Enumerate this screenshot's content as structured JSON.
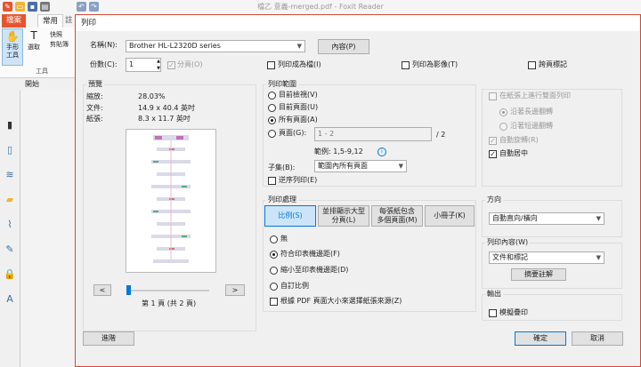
{
  "app": {
    "title": "檔乙 意義-merged.pdf - Foxit Reader",
    "tabs": [
      "檔案",
      "常用",
      "註"
    ],
    "tools": {
      "hand_label": "手形\n工具",
      "select_label": "選取",
      "snapshot_label": "快照",
      "clipboard_label": "剪貼簿",
      "group_label": "工具"
    },
    "doc_tab": "開始"
  },
  "dialog": {
    "title": "列印",
    "printer": {
      "name_label": "名稱(N):",
      "name_value": "Brother HL-L2320D series",
      "properties_button": "內容(P)"
    },
    "copies": {
      "label": "份數(C):",
      "value": "1",
      "collate_label": "分頁(O)"
    },
    "print_to_file_label": "列印成為檔(I)",
    "print_as_image_label": "列印為影像(T)",
    "cross_page_label": "跨頁標記",
    "preview": {
      "title": "預覽",
      "scale_label": "縮放:",
      "scale_value": "28.03%",
      "document_label": "文件:",
      "document_value": "14.9 x 40.4 英吋",
      "paper_label": "紙張:",
      "paper_value": "8.3 x 11.7 英吋",
      "prev_button": "<",
      "next_button": ">",
      "page_info": "第 1 頁 (共 2 頁)",
      "slider_fraction": 0.0
    },
    "range": {
      "title": "列印範圍",
      "current_view": "目前檢視(V)",
      "current_page": "目前頁面(U)",
      "all_pages": "所有頁面(A)",
      "pages_label": "頁面(G):",
      "pages_value": "1 - 2",
      "pages_total": "/ 2",
      "example_text": "範例: 1,5-9,12",
      "subset_label": "子集(B):",
      "subset_value": "範圍內所有頁面",
      "reverse_label": "逆序列印(E)"
    },
    "handling": {
      "title": "列印處理",
      "buttons": [
        "比例(S)",
        "並排顯示大型\n分頁(L)",
        "每張紙包含\n多個頁面(M)",
        "小冊子(K)"
      ],
      "none": "無",
      "fit_printable": "符合印表機邊距(F)",
      "shrink_printable": "縮小至印表機邊距(D)",
      "custom_scale": "自訂比例",
      "choose_paper_label": "根據 PDF 頁面大小來選擇紙張來源(Z)"
    },
    "duplex": {
      "both_sides_label": "在紙張上進行雙面列印",
      "flip_long": "沿著長邊翻轉",
      "flip_short": "沿著短邊翻轉",
      "auto_rotate": "自動旋轉(R)",
      "auto_center": "自動居中"
    },
    "orientation": {
      "title": "方向",
      "value": "自動直向/橫向"
    },
    "content": {
      "title": "列印內容(W)",
      "value": "文件和標記",
      "summarize_button": "摘要註解"
    },
    "output": {
      "title": "輸出",
      "simulate_overprint": "模擬疊印"
    },
    "advanced_button": "進階",
    "ok_button": "確定",
    "cancel_button": "取消"
  }
}
